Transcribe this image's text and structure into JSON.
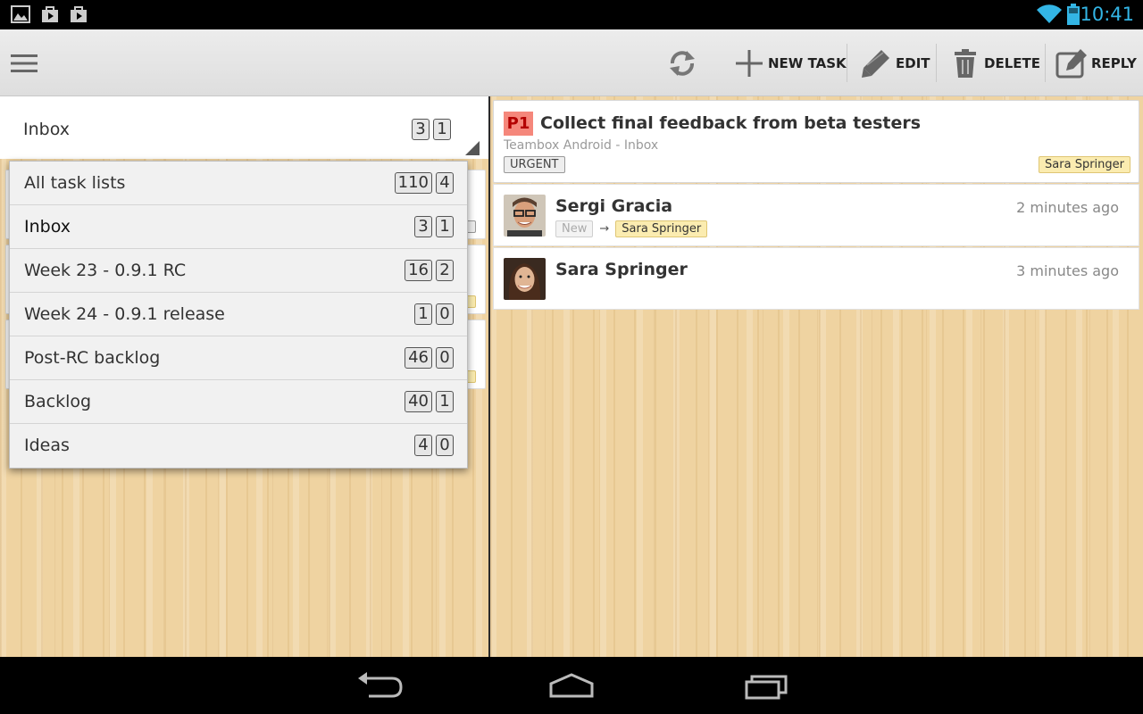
{
  "status_bar": {
    "time": "10:41"
  },
  "toolbar": {
    "new_task_label": "NEW TASK",
    "edit_label": "EDIT",
    "delete_label": "DELETE",
    "reply_label": "REPLY"
  },
  "list_selector": {
    "selected": {
      "label": "Inbox",
      "count": "3",
      "unread": "1"
    },
    "options": [
      {
        "label": "All task lists",
        "count": "110",
        "unread": "4"
      },
      {
        "label": "Inbox",
        "count": "3",
        "unread": "1"
      },
      {
        "label": "Week 23 - 0.9.1 RC",
        "count": "16",
        "unread": "2"
      },
      {
        "label": "Week 24 - 0.9.1 release",
        "count": "1",
        "unread": "0"
      },
      {
        "label": "Post-RC backlog",
        "count": "46",
        "unread": "0"
      },
      {
        "label": "Backlog",
        "count": "40",
        "unread": "1"
      },
      {
        "label": "Ideas",
        "count": "4",
        "unread": "0"
      }
    ]
  },
  "task": {
    "priority": "P1",
    "title": "Collect final feedback from beta testers",
    "subtitle": "Teambox Android - Inbox",
    "tag": "URGENT",
    "assignee": "Sara Springer"
  },
  "comments": [
    {
      "name": "Sergi Gracia",
      "time": "2 minutes ago",
      "status_from": "New",
      "assigned_to": "Sara Springer"
    },
    {
      "name": "Sara Springer",
      "time": "3 minutes ago"
    }
  ],
  "colors": {
    "accent": "#33b5e5",
    "priority_bg": "#f5877b",
    "assignee_bg": "#fbecb0",
    "wood": "#efd3a1"
  }
}
